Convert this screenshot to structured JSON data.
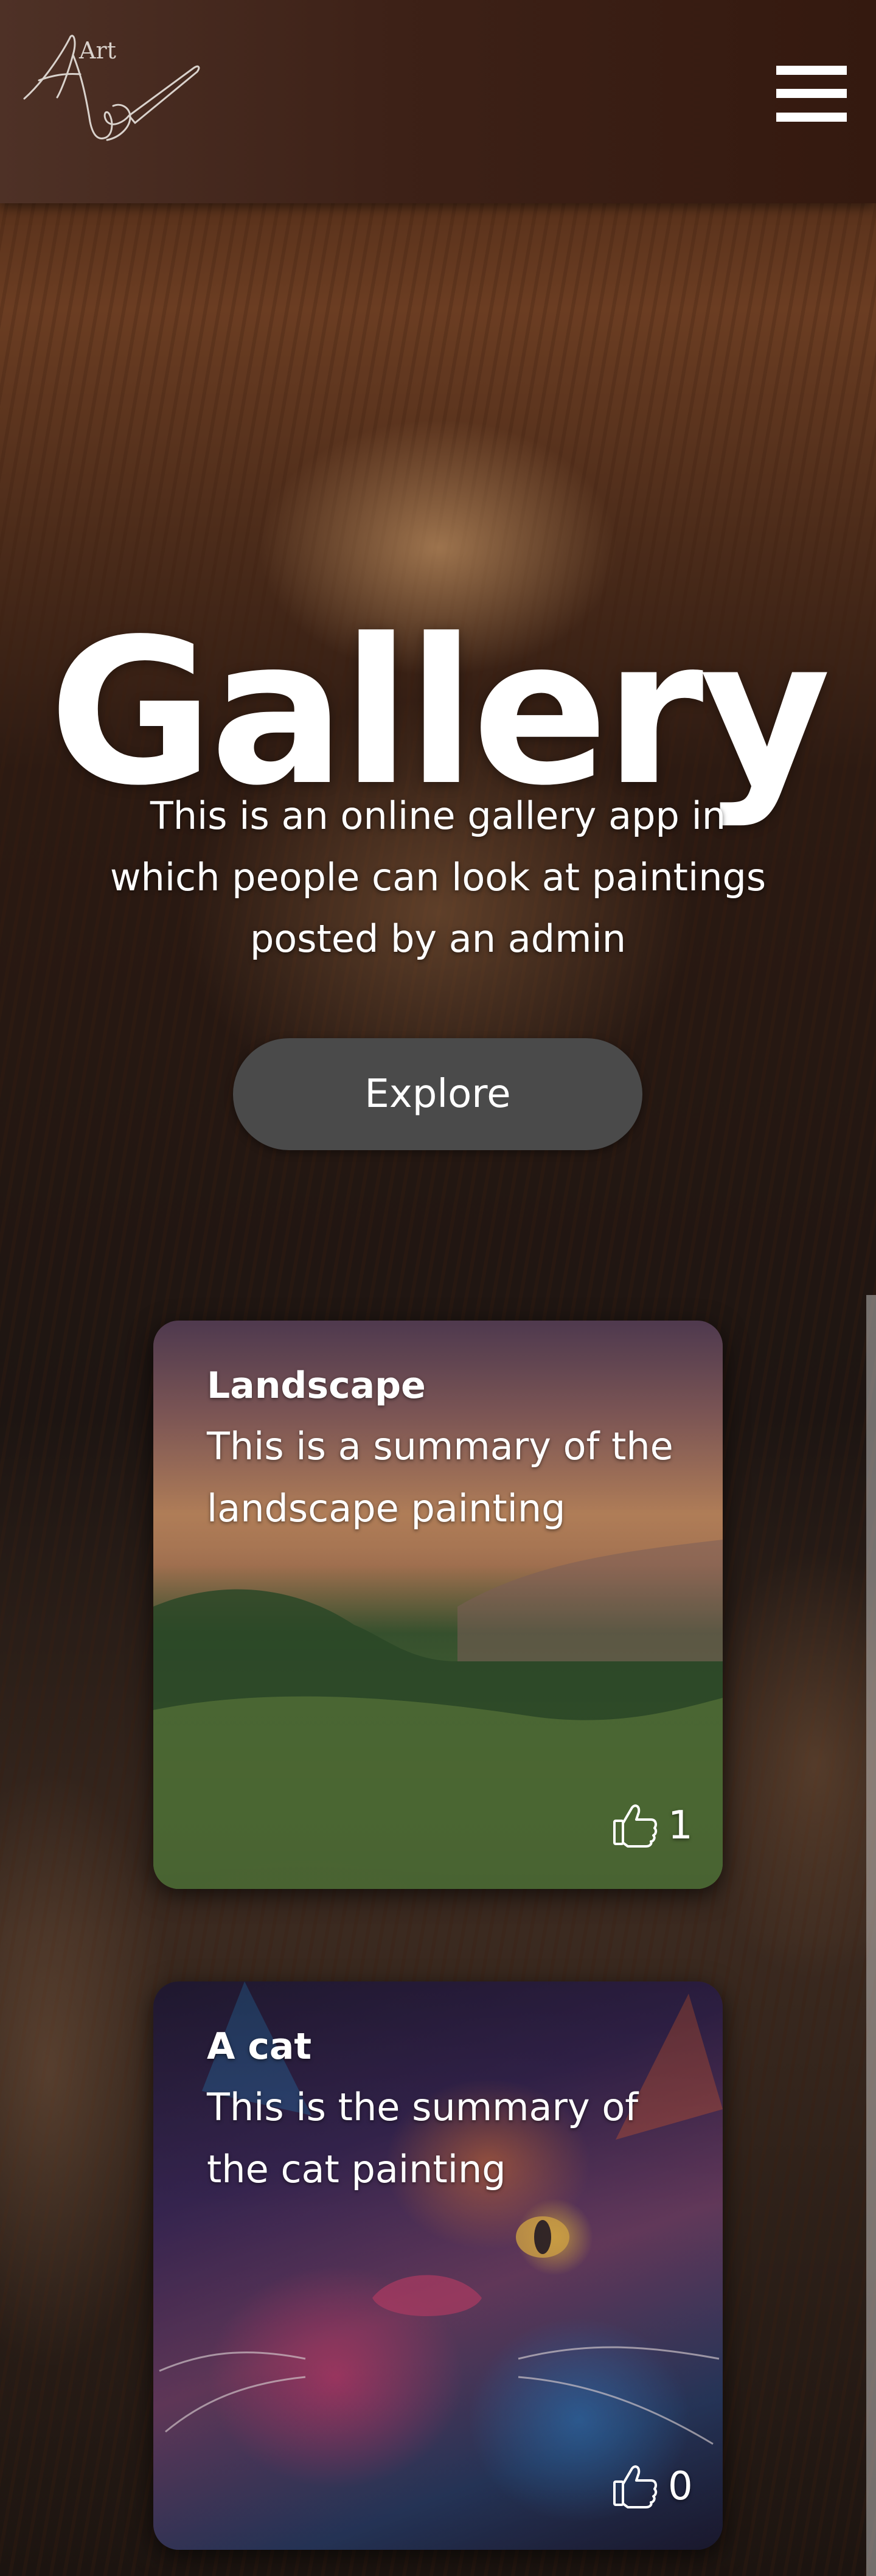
{
  "header": {
    "logo_text": "Art",
    "menu_icon": "hamburger-menu-icon"
  },
  "hero": {
    "title": "Gallery",
    "subtitle": "This is an online gallery app in which people can look at paintings posted by an admin",
    "explore_label": "Explore"
  },
  "cards": [
    {
      "title": "Landscape",
      "summary": "This is a summary of the landscape painting",
      "like_icon": "thumbs-up-icon",
      "likes": "1"
    },
    {
      "title": "A cat",
      "summary": "This is the summary of the cat painting",
      "like_icon": "thumbs-up-icon",
      "likes": "0"
    }
  ]
}
